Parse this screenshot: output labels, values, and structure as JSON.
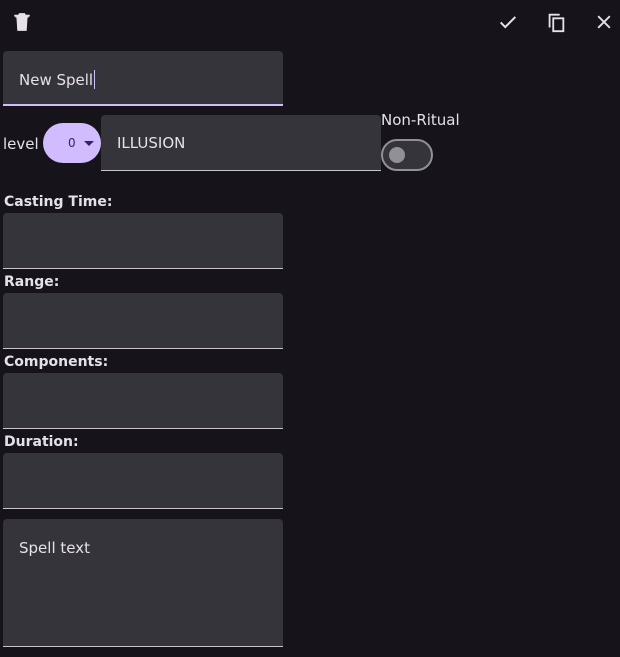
{
  "toolbar": {
    "delete_icon": "trash-icon",
    "save_icon": "checkmark-icon",
    "duplicate_icon": "copy-icon",
    "close_icon": "close-icon"
  },
  "name_field": {
    "value": "New Spell"
  },
  "level": {
    "label": "level",
    "selected_value": "0"
  },
  "school": {
    "value": "ILLUSION"
  },
  "ritual": {
    "label": "Non-Ritual",
    "enabled": false
  },
  "sections": {
    "casting_time_label": "Casting Time:",
    "casting_time_value": "",
    "range_label": "Range:",
    "range_value": "",
    "components_label": "Components:",
    "components_value": "",
    "duration_label": "Duration:",
    "duration_value": ""
  },
  "spell_text": {
    "placeholder": "Spell text",
    "value": ""
  },
  "colors": {
    "background": "#16131a",
    "field_fill": "#36343b",
    "accent": "#d0bcff",
    "on_accent": "#381e72",
    "text": "#e6e1e8",
    "outline": "#938f99"
  }
}
